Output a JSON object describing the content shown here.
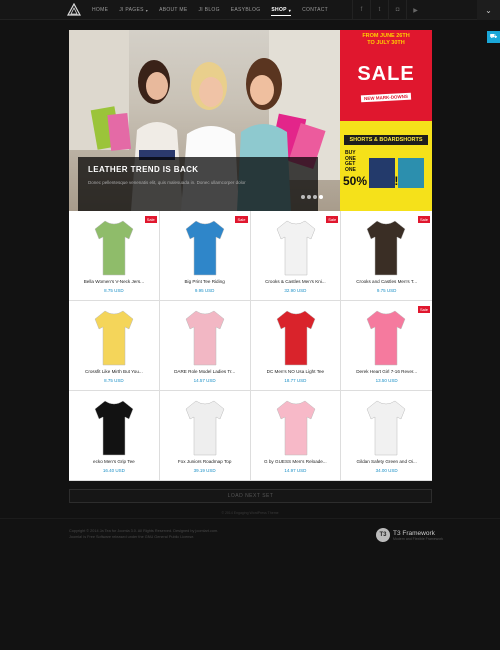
{
  "nav": {
    "items": [
      {
        "label": "HOME"
      },
      {
        "label": "JI PAGES",
        "caret": "▾"
      },
      {
        "label": "ABOUT ME"
      },
      {
        "label": "JI BLOG"
      },
      {
        "label": "EASYBLOG"
      },
      {
        "label": "SHOP",
        "caret": "▾",
        "active": true
      },
      {
        "label": "CONTACT"
      }
    ],
    "social_icons": [
      "facebook-icon",
      "twitter-icon",
      "instagram-icon",
      "youtube-icon"
    ]
  },
  "hero": {
    "caption_title": "LEATHER TREND IS BACK",
    "caption_text": "Donec pellentesque venenatis elit, quis malesuada in. Donec ullamcorper dolor"
  },
  "promo_sale": {
    "dates_line1": "FROM JUNE 26TH",
    "dates_line2": "TO JULY 30TH",
    "title": "SALE",
    "subtitle": "NEW MARK-DOWNS"
  },
  "promo_shorts": {
    "title": "SHORTS & BOARDSHORTS",
    "offer": "BUY ONE GET ONE",
    "discount": "50% OFF!"
  },
  "products": [
    {
      "name": "Bella Women's V-Neck Jers...",
      "price": "8.75 USD",
      "sale": true,
      "color": "#8fbc6a"
    },
    {
      "name": "Big Print Tee Riding",
      "price": "9.95 USD",
      "sale": true,
      "color": "#2f86c9"
    },
    {
      "name": "Crooks & Castles Men's Kni...",
      "price": "32.90 USD",
      "sale": true,
      "color": "#f2f2f2"
    },
    {
      "name": "Crooks and Castles Men's T...",
      "price": "9.75 USD",
      "sale": true,
      "color": "#3a2e25"
    },
    {
      "name": "Crossfit Like Mirth But You...",
      "price": "8.75 USD",
      "sale": false,
      "color": "#f4d55a"
    },
    {
      "name": "DARE Role Model Ladies Tr...",
      "price": "14.57 USD",
      "sale": false,
      "color": "#f2b7c4"
    },
    {
      "name": "DC Men's NO Usa Light Tee",
      "price": "18.77 USD",
      "sale": false,
      "color": "#d9232b"
    },
    {
      "name": "Derek Heart Girl 7-16 Rever...",
      "price": "13.50 USD",
      "sale": true,
      "color": "#f57a9e"
    },
    {
      "name": "ecko Men's Grip Tee",
      "price": "16.40 USD",
      "sale": false,
      "color": "#121212"
    },
    {
      "name": "Fox Juniors Roadmap Top",
      "price": "39.19 USD",
      "sale": false,
      "color": "#eeeeee"
    },
    {
      "name": "G by GUESS Men's Reloade...",
      "price": "14.97 USD",
      "sale": false,
      "color": "#f7b9c8"
    },
    {
      "name": "Gildan Safety Green and Oi...",
      "price": "34.00 USD",
      "sale": false,
      "color": "#f1f1f1"
    }
  ],
  "sale_label": "Sale",
  "load_next": "LOAD NEXT SET",
  "tiny_link": "© 2014 Engaging WordPress Theme",
  "footer": {
    "copyright": "Copyright © 2014 Ja Tea for Joomla 3.0. All Rights Reserved. Designed by joomlart.com.",
    "license": "Joomla! is Free Software released under the GNU General Public License.",
    "brand_name": "T3 Framework",
    "brand_sub": "Modern and Flexible Framework"
  }
}
